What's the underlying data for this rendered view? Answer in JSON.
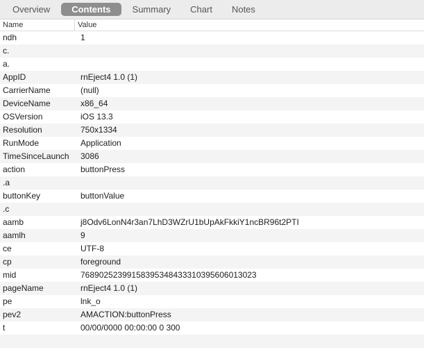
{
  "tabs": [
    {
      "label": "Overview",
      "active": false
    },
    {
      "label": "Contents",
      "active": true
    },
    {
      "label": "Summary",
      "active": false
    },
    {
      "label": "Chart",
      "active": false
    },
    {
      "label": "Notes",
      "active": false
    }
  ],
  "columns": {
    "name": "Name",
    "value": "Value"
  },
  "rows": [
    {
      "name": "ndh",
      "value": "1"
    },
    {
      "name": "c.",
      "value": ""
    },
    {
      "name": "a.",
      "value": ""
    },
    {
      "name": "AppID",
      "value": "rnEject4 1.0 (1)"
    },
    {
      "name": "CarrierName",
      "value": "(null)"
    },
    {
      "name": "DeviceName",
      "value": "x86_64"
    },
    {
      "name": "OSVersion",
      "value": "iOS 13.3"
    },
    {
      "name": "Resolution",
      "value": "750x1334"
    },
    {
      "name": "RunMode",
      "value": "Application"
    },
    {
      "name": "TimeSinceLaunch",
      "value": "3086"
    },
    {
      "name": "action",
      "value": "buttonPress"
    },
    {
      "name": ".a",
      "value": ""
    },
    {
      "name": "buttonKey",
      "value": "buttonValue"
    },
    {
      "name": ".c",
      "value": ""
    },
    {
      "name": "aamb",
      "value": "j8Odv6LonN4r3an7LhD3WZrU1bUpAkFkkiY1ncBR96t2PTI"
    },
    {
      "name": "aamlh",
      "value": "9"
    },
    {
      "name": "ce",
      "value": "UTF-8"
    },
    {
      "name": "cp",
      "value": "foreground"
    },
    {
      "name": "mid",
      "value": "76890252399158395348433310395606013023"
    },
    {
      "name": "pageName",
      "value": "rnEject4 1.0 (1)"
    },
    {
      "name": "pe",
      "value": "lnk_o"
    },
    {
      "name": "pev2",
      "value": "AMACTION:buttonPress"
    },
    {
      "name": "t",
      "value": "00/00/0000 00:00:00 0 300"
    },
    {
      "name": "",
      "value": ""
    },
    {
      "name": "",
      "value": ""
    }
  ]
}
